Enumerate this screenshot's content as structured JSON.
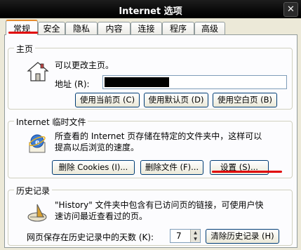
{
  "window": {
    "title": "Internet 选项",
    "close_glyph": "✕"
  },
  "tabs": [
    "常规",
    "安全",
    "隐私",
    "内容",
    "连接",
    "程序",
    "高级"
  ],
  "homepage": {
    "group_title": "主页",
    "description": "可以更改主页。",
    "address_label": "地址",
    "address_hotkey": "(R):",
    "address_value": "",
    "buttons": [
      "使用当前页 (C)",
      "使用默认页 (D)",
      "使用空白页 (B)"
    ]
  },
  "temp_files": {
    "group_title": "Internet 临时文件",
    "description_line1": "所查看的 Internet 页存储在特定的文件夹中，这样可以",
    "description_line2": "提高以后浏览的速度。",
    "buttons": [
      "删除 Cookies (I)...",
      "删除文件 (F)...",
      "设置 (S)..."
    ]
  },
  "history": {
    "group_title": "历史记录",
    "description_line1": "\"History\" 文件夹中包含有已访问页的链接，可使用户快",
    "description_line2": "速访问最近查看过的页。",
    "days_label": "网页保存在历史记录中的天数 (K):",
    "days_value": "7",
    "clear_button": "清除历史记录 (H)"
  },
  "colors": {
    "annotation_red": "#e00000",
    "titlebar": "#000000",
    "dialog_bg": "#ece9d8"
  },
  "icons": [
    "house-icon",
    "ie-globe-icon",
    "history-sundial-icon",
    "close-icon"
  ]
}
